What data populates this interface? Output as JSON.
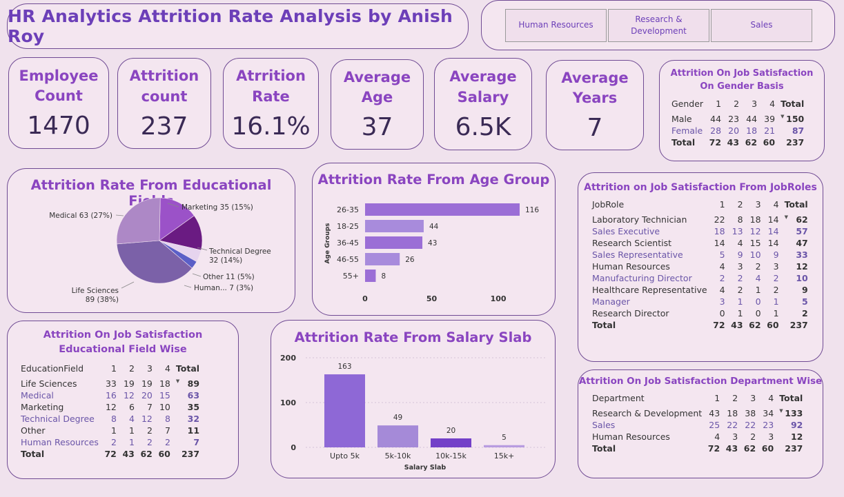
{
  "header": {
    "title": "HR Analytics Attrition Rate Analysis by Anish Roy"
  },
  "slicer": {
    "buttons": [
      "Human Resources",
      "Research &\nDevelopment",
      "Sales"
    ]
  },
  "kpis": [
    {
      "label_line1": "Employee",
      "label_line2": "Count",
      "value": "1470"
    },
    {
      "label_line1": "Attrition",
      "label_line2": "count",
      "value": "237"
    },
    {
      "label_line1": "Atrrition",
      "label_line2": "Rate",
      "value": "16.1%"
    },
    {
      "label_line1": "Average",
      "label_line2": "Age",
      "value": "37"
    },
    {
      "label_line1": "Average",
      "label_line2": "Salary",
      "value": "6.5K"
    },
    {
      "label_line1": "Average",
      "label_line2": "Years",
      "value": "7"
    }
  ],
  "gender_table": {
    "title": "Attrition On Job Satisfaction On Gender Basis",
    "headers": [
      "Gender",
      "1",
      "2",
      "3",
      "4",
      "Total"
    ],
    "rows": [
      [
        "Male",
        "44",
        "23",
        "44",
        "39",
        "150"
      ],
      [
        "Female",
        "28",
        "20",
        "18",
        "21",
        "87"
      ]
    ],
    "total": [
      "Total",
      "72",
      "43",
      "62",
      "60",
      "237"
    ]
  },
  "edu_table": {
    "title": "Attrition On Job Satisfaction Educational Field Wise",
    "headers": [
      "EducationField",
      "1",
      "2",
      "3",
      "4",
      "Total"
    ],
    "rows": [
      [
        "Life Sciences",
        "33",
        "19",
        "19",
        "18",
        "89"
      ],
      [
        "Medical",
        "16",
        "12",
        "20",
        "15",
        "63"
      ],
      [
        "Marketing",
        "12",
        "6",
        "7",
        "10",
        "35"
      ],
      [
        "Technical Degree",
        "8",
        "4",
        "12",
        "8",
        "32"
      ],
      [
        "Other",
        "1",
        "1",
        "2",
        "7",
        "11"
      ],
      [
        "Human Resources",
        "2",
        "1",
        "2",
        "2",
        "7"
      ]
    ],
    "total": [
      "Total",
      "72",
      "43",
      "62",
      "60",
      "237"
    ]
  },
  "jobrole_table": {
    "title": "Attrition on Job Satisfaction From JobRoles",
    "headers": [
      "JobRole",
      "1",
      "2",
      "3",
      "4",
      "Total"
    ],
    "rows": [
      [
        "Laboratory Technician",
        "22",
        "8",
        "18",
        "14",
        "62"
      ],
      [
        "Sales Executive",
        "18",
        "13",
        "12",
        "14",
        "57"
      ],
      [
        "Research Scientist",
        "14",
        "4",
        "15",
        "14",
        "47"
      ],
      [
        "Sales Representative",
        "5",
        "9",
        "10",
        "9",
        "33"
      ],
      [
        "Human Resources",
        "4",
        "3",
        "2",
        "3",
        "12"
      ],
      [
        "Manufacturing Director",
        "2",
        "2",
        "4",
        "2",
        "10"
      ],
      [
        "Healthcare Representative",
        "4",
        "2",
        "1",
        "2",
        "9"
      ],
      [
        "Manager",
        "3",
        "1",
        "0",
        "1",
        "5"
      ],
      [
        "Research Director",
        "0",
        "1",
        "0",
        "1",
        "2"
      ]
    ],
    "total": [
      "Total",
      "72",
      "43",
      "62",
      "60",
      "237"
    ]
  },
  "dept_table": {
    "title": "Attrition On Job Satisfaction Department Wise",
    "headers": [
      "Department",
      "1",
      "2",
      "3",
      "4",
      "Total"
    ],
    "rows": [
      [
        "Research & Development",
        "43",
        "18",
        "38",
        "34",
        "133"
      ],
      [
        "Sales",
        "25",
        "22",
        "22",
        "23",
        "92"
      ],
      [
        "Human Resources",
        "4",
        "3",
        "2",
        "3",
        "12"
      ]
    ],
    "total": [
      "Total",
      "72",
      "43",
      "62",
      "60",
      "237"
    ]
  },
  "chart_data": [
    {
      "type": "pie",
      "title": "Attrition Rate From Educational Fields",
      "slices": [
        {
          "label": "Marketing 35 (15%)",
          "value": 35,
          "color": "#9b52c8"
        },
        {
          "label": "Technical Degree\n32 (14%)",
          "value": 32,
          "color": "#6a1b82"
        },
        {
          "label": "Other 11 (5%)",
          "value": 11,
          "color": "#e6d4ee"
        },
        {
          "label": "Human... 7 (3%)",
          "value": 7,
          "color": "#5b5fc7"
        },
        {
          "label": "Life Sciences\n89 (38%)",
          "value": 89,
          "color": "#7b61a8"
        },
        {
          "label": "Medical 63 (27%)",
          "value": 63,
          "color": "#ad88c6"
        }
      ]
    },
    {
      "type": "bar",
      "orientation": "horizontal",
      "title": "Attrition Rate From Age Group",
      "ylabel": "Age Groups",
      "categories": [
        "26-35",
        "18-25",
        "36-45",
        "46-55",
        "55+"
      ],
      "values": [
        116,
        44,
        43,
        26,
        8
      ],
      "colors": [
        "#9b6ed6",
        "#a88bdc",
        "#9b6ed6",
        "#a88bdc",
        "#9b6ed6"
      ],
      "xlim": [
        0,
        116
      ],
      "xticks": [
        0,
        50,
        100
      ]
    },
    {
      "type": "bar",
      "title": "Attrition Rate From Salary Slab",
      "xlabel": "Salary Slab",
      "categories": [
        "Upto 5k",
        "5k-10k",
        "10k-15k",
        "15k+"
      ],
      "values": [
        163,
        49,
        20,
        5
      ],
      "colors": [
        "#8e68d6",
        "#a58ad8",
        "#7340c8",
        "#b89ce0"
      ],
      "ylim": [
        0,
        200
      ],
      "yticks": [
        0,
        100,
        200
      ]
    }
  ]
}
